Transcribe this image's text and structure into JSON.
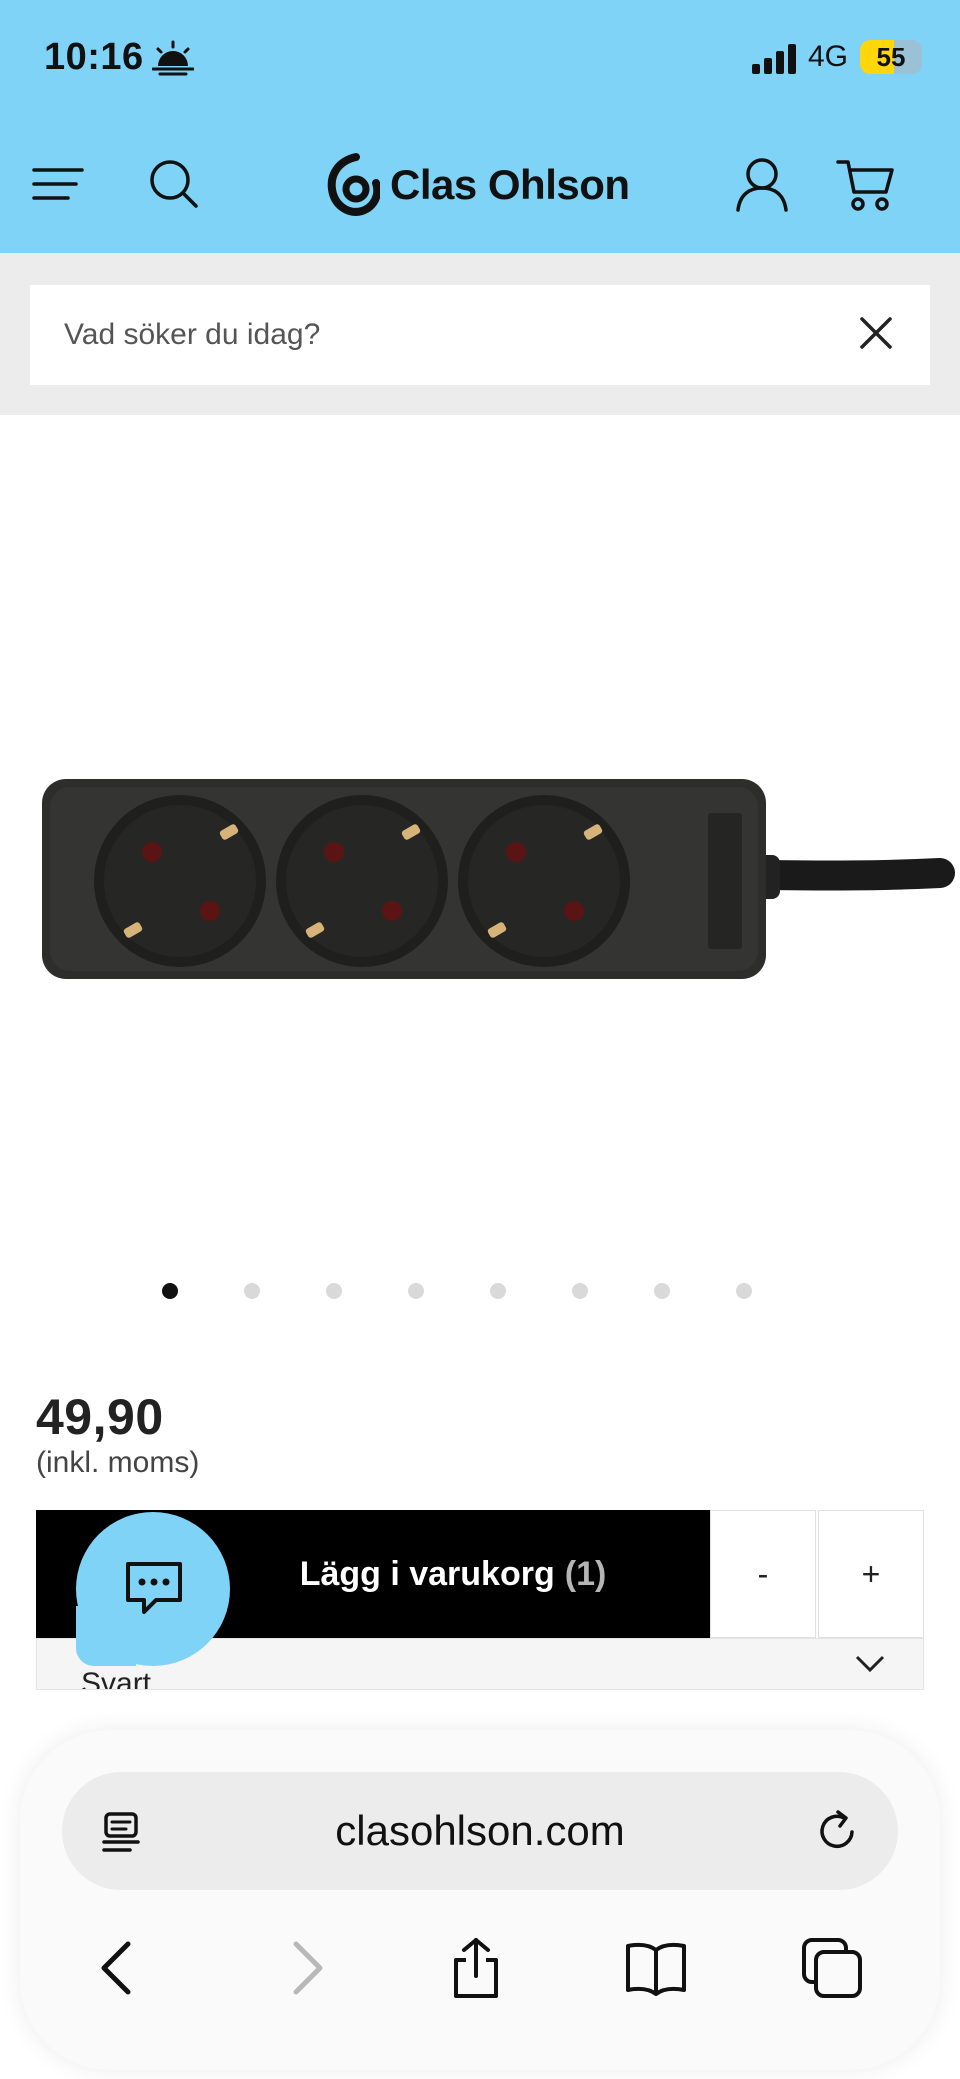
{
  "status_bar": {
    "time": "10:16",
    "network": "4G",
    "battery": "55",
    "battery_level": 0.55,
    "icons": [
      "sunrise-icon",
      "signal-icon"
    ]
  },
  "header": {
    "brand": "Clas Ohlson",
    "icons": [
      "menu-icon",
      "search-icon",
      "user-icon",
      "cart-icon"
    ]
  },
  "search": {
    "placeholder": "Vad söker du idag?"
  },
  "product": {
    "image_dots_total": 8,
    "image_dot_active": 1,
    "price": "49,90",
    "price_note": "(inkl. moms)",
    "add_to_cart_label": "Lägg i varukorg",
    "add_to_cart_count": "(1)",
    "qty_minus_label": "-",
    "qty_plus_label": "+",
    "variant": "Svart"
  },
  "browser": {
    "url": "clasohlson.com",
    "icons": [
      "reader-icon",
      "reload-icon",
      "back-icon",
      "forward-icon",
      "share-icon",
      "bookmarks-icon",
      "tabs-icon"
    ]
  },
  "colors": {
    "header_bg": "#7fd3f7",
    "search_bg": "#ececec",
    "button_bg": "#000000",
    "battery_fill": "#ffd60a"
  }
}
